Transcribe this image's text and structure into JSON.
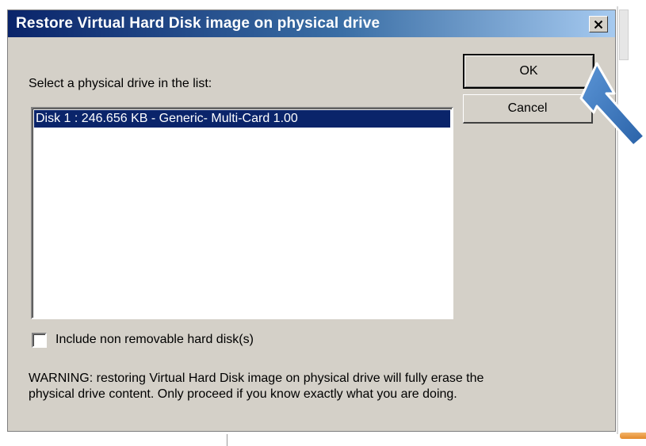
{
  "dialog": {
    "title": "Restore Virtual Hard Disk image on physical drive",
    "select_label": "Select a physical drive in the list:",
    "drives": [
      {
        "label": "Disk 1 : 246.656 KB - Generic- Multi-Card 1.00",
        "selected": true
      }
    ],
    "ok_label": "OK",
    "cancel_label": "Cancel",
    "checkbox": {
      "label": "Include non removable hard disk(s)",
      "checked": false
    },
    "warning_lines": [
      "WARNING: restoring Virtual Hard Disk image on physical drive will fully erase the",
      "physical drive content. Only proceed if you know exactly what you are doing."
    ]
  },
  "icons": {
    "close": "close-icon",
    "pointer": "pointer-arrow-icon"
  },
  "colors": {
    "titlebar_start": "#0a246a",
    "titlebar_end": "#a6caf0",
    "dialog_bg": "#d4d0c8",
    "selection": "#0a246a",
    "arrow": "#2f6db5"
  }
}
